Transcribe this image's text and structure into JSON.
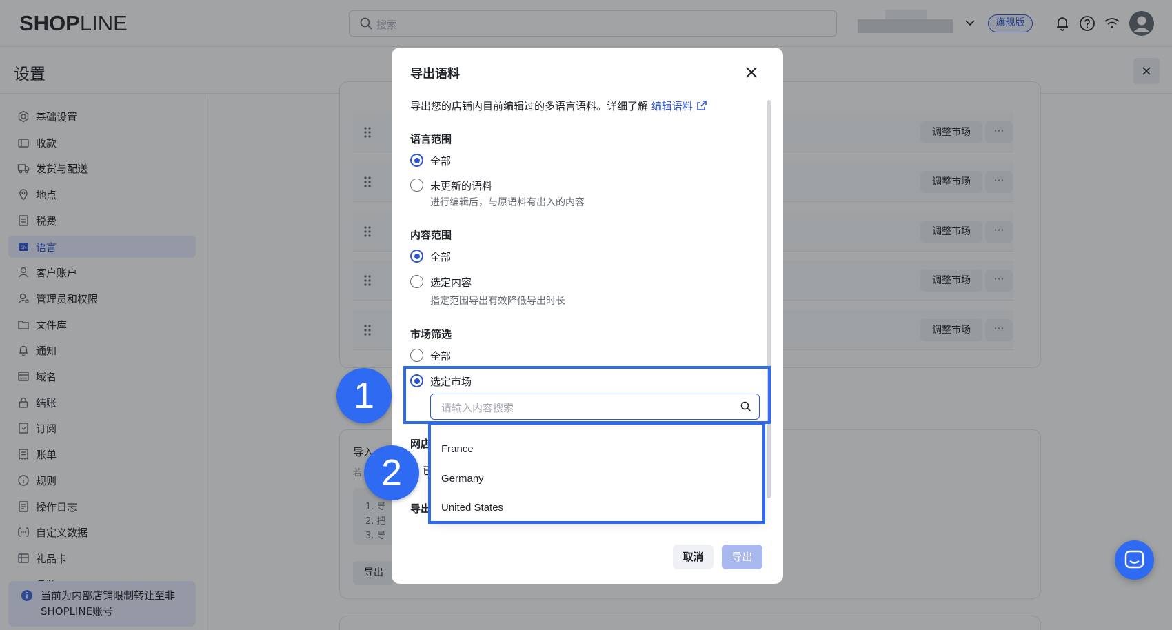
{
  "header": {
    "logo_bold": "SHOP",
    "logo_light": "LINE",
    "search_placeholder": "搜索",
    "plan_badge": "旗舰版"
  },
  "settings": {
    "title": "设置"
  },
  "sidebar": {
    "items": [
      {
        "label": "基础设置",
        "icon": "gear-icon"
      },
      {
        "label": "收款",
        "icon": "wallet-icon"
      },
      {
        "label": "发货与配送",
        "icon": "truck-icon"
      },
      {
        "label": "地点",
        "icon": "location-icon"
      },
      {
        "label": "税费",
        "icon": "tax-icon"
      },
      {
        "label": "语言",
        "icon": "language-icon",
        "active": true
      },
      {
        "label": "客户账户",
        "icon": "user-icon"
      },
      {
        "label": "管理员和权限",
        "icon": "admin-icon"
      },
      {
        "label": "文件库",
        "icon": "folder-icon"
      },
      {
        "label": "通知",
        "icon": "bell-icon"
      },
      {
        "label": "域名",
        "icon": "domain-icon"
      },
      {
        "label": "结账",
        "icon": "lock-icon"
      },
      {
        "label": "订阅",
        "icon": "subscribe-icon"
      },
      {
        "label": "账单",
        "icon": "bill-icon"
      },
      {
        "label": "规则",
        "icon": "info-icon"
      },
      {
        "label": "操作日志",
        "icon": "log-icon"
      },
      {
        "label": "自定义数据",
        "icon": "custom-data-icon"
      },
      {
        "label": "礼品卡",
        "icon": "gift-card-icon"
      },
      {
        "label": "品牌",
        "icon": "brand-icon"
      }
    ],
    "notice": "当前为内部店铺限制转让至非SHOPLINE账号"
  },
  "main": {
    "rows_adjust_label": "调整市场",
    "rows_more_label": "···",
    "import_title": "导入",
    "import_sub": "若",
    "import_steps": [
      "1. 导",
      "2. 把",
      "3. 导"
    ],
    "import_button": "导出"
  },
  "modal": {
    "title": "导出语料",
    "description": "导出您的店铺内目前编辑过的多语言语料。详细了解",
    "link": "编辑语料",
    "language_scope": {
      "title": "语言范围",
      "options": [
        "全部",
        "未更新的语料"
      ],
      "hint": "进行编辑后，与原语料有出入的内容",
      "selected": "全部"
    },
    "content_scope": {
      "title": "内容范围",
      "options": [
        "全部",
        "选定内容"
      ],
      "hint": "指定范围导出有效降低导出时长",
      "selected": "全部"
    },
    "market_filter": {
      "title": "市场筛选",
      "options": [
        "全部",
        "选定市场"
      ],
      "selected": "选定市场",
      "search_placeholder": "请输入内容搜索",
      "markets": [
        "France",
        "Germany",
        "United States"
      ]
    },
    "partial_labels": [
      "网店",
      "已",
      "导出"
    ],
    "cancel": "取消",
    "export": "导出"
  },
  "annotations": {
    "marker1": "1",
    "marker2": "2",
    "color": "#2f6af2"
  }
}
